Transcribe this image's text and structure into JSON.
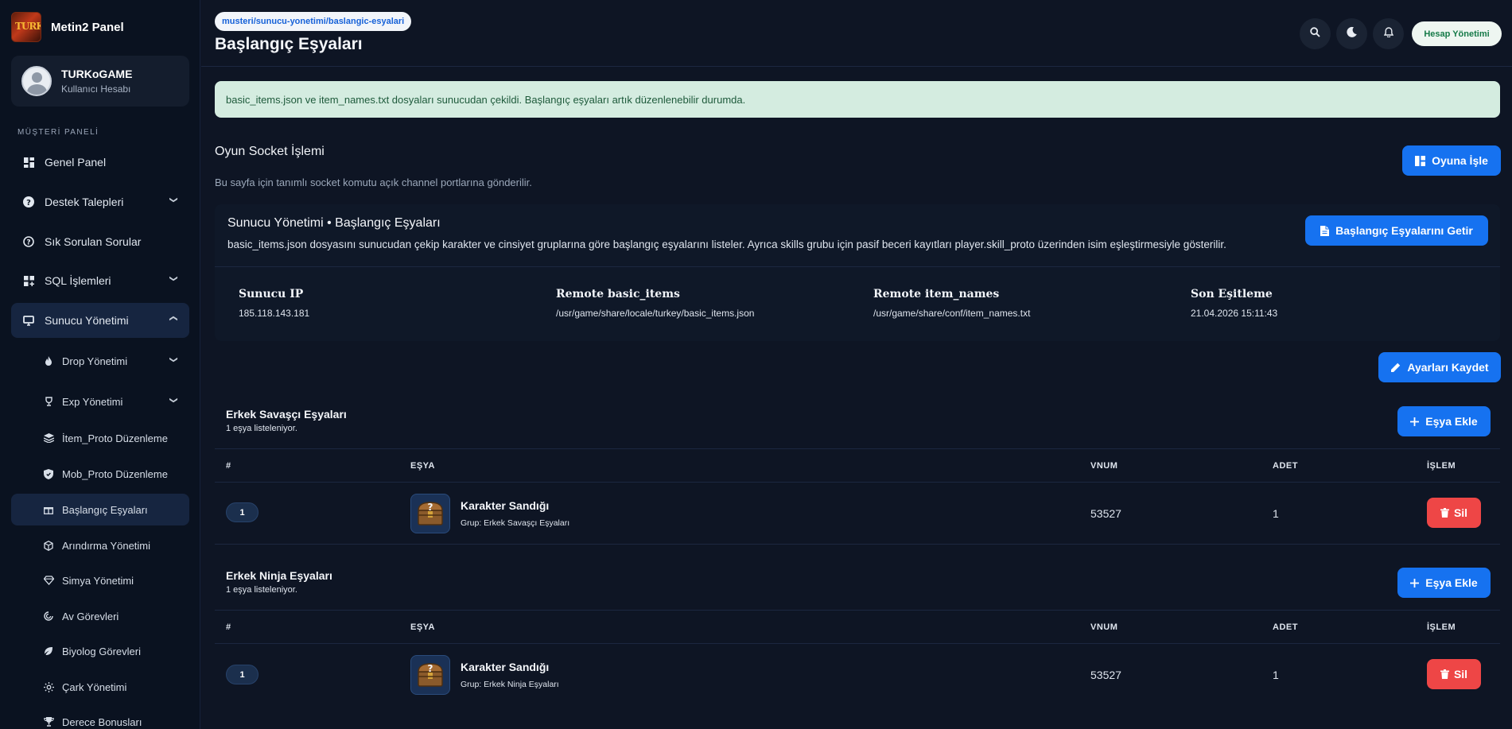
{
  "brand": {
    "name": "Metin2 Panel",
    "logo_text": "TURK"
  },
  "user": {
    "name": "TURKoGAME",
    "role": "Kullanıcı Hesabı"
  },
  "sidebar": {
    "section_label": "MÜŞTERİ PANELİ",
    "items": [
      {
        "label": "Genel Panel",
        "icon": "dashboard-icon"
      },
      {
        "label": "Destek Talepleri",
        "icon": "help-circle-icon"
      },
      {
        "label": "Sık Sorulan Sorular",
        "icon": "question-circle-icon"
      },
      {
        "label": "SQL İşlemleri",
        "icon": "grid-plus-icon"
      },
      {
        "label": "Sunucu Yönetimi",
        "icon": "monitor-icon"
      }
    ],
    "subitems": [
      {
        "label": "Drop Yönetimi",
        "icon": "flame-icon"
      },
      {
        "label": "Exp Yönetimi",
        "icon": "trophy-icon"
      },
      {
        "label": "İtem_Proto Düzenleme",
        "icon": "layers-icon"
      },
      {
        "label": "Mob_Proto Düzenleme",
        "icon": "shield-icon"
      },
      {
        "label": "Başlangıç Eşyaları",
        "icon": "gift-icon"
      },
      {
        "label": "Arındırma Yönetimi",
        "icon": "cube-icon"
      },
      {
        "label": "Simya Yönetimi",
        "icon": "gem-icon"
      },
      {
        "label": "Av Görevleri",
        "icon": "target-icon"
      },
      {
        "label": "Biyolog Görevleri",
        "icon": "leaf-icon"
      },
      {
        "label": "Çark Yönetimi",
        "icon": "sun-icon"
      },
      {
        "label": "Derece Bonusları",
        "icon": "trophy-cup-icon"
      }
    ]
  },
  "header": {
    "breadcrumb": "musteri/sunucu-yonetimi/baslangic-esyalari",
    "title": "Başlangıç Eşyaları",
    "account_button": "Hesap Yönetimi"
  },
  "alert": {
    "text": "basic_items.json ve item_names.txt dosyaları sunucudan çekildi. Başlangıç eşyaları artık düzenlenebilir durumda."
  },
  "socket": {
    "title": "Oyun Socket İşlemi",
    "description": "Bu sayfa için tanımlı socket komutu açık channel portlarına gönderilir.",
    "button": "Oyuna İşle"
  },
  "server_card": {
    "title": "Sunucu Yönetimi • Başlangıç Eşyaları",
    "description": "basic_items.json dosyasını sunucudan çekip karakter ve cinsiyet gruplarına göre başlangıç eşyalarını listeler. Ayrıca skills grubu için pasif beceri kayıtları player.skill_proto üzerinden isim eşleştirmesiyle gösterilir.",
    "fetch_button": "Başlangıç Eşyalarını Getir",
    "meta": [
      {
        "label": "Sunucu IP",
        "value": "185.118.143.181"
      },
      {
        "label": "Remote basic_items",
        "value": "/usr/game/share/locale/turkey/basic_items.json"
      },
      {
        "label": "Remote item_names",
        "value": "/usr/game/share/conf/item_names.txt"
      },
      {
        "label": "Son Eşitleme",
        "value": "21.04.2026 15:11:43"
      }
    ]
  },
  "save_button": "Ayarları Kaydet",
  "table_headers": {
    "index": "#",
    "item": "EŞYA",
    "vnum": "VNUM",
    "count": "ADET",
    "action": "İŞLEM"
  },
  "groups": [
    {
      "title": "Erkek Savaşçı Eşyaları",
      "subtitle": "1 eşya listeleniyor.",
      "add_button": "Eşya Ekle",
      "rows": [
        {
          "index": "1",
          "name": "Karakter Sandığı",
          "group": "Grup: Erkek Savaşçı Eşyaları",
          "vnum": "53527",
          "count": "1",
          "delete": "Sil"
        }
      ]
    },
    {
      "title": "Erkek Ninja Eşyaları",
      "subtitle": "1 eşya listeleniyor.",
      "add_button": "Eşya Ekle",
      "rows": [
        {
          "index": "1",
          "name": "Karakter Sandığı",
          "group": "Grup: Erkek Ninja Eşyaları",
          "vnum": "53527",
          "count": "1",
          "delete": "Sil"
        }
      ]
    }
  ]
}
